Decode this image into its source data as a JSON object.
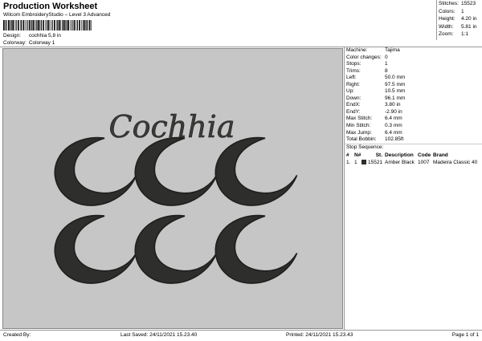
{
  "header": {
    "title": "Production Worksheet",
    "subtitle": "Wilcom EmbroideryStudio – Level 3 Advanced"
  },
  "design": {
    "label": "Design:",
    "value": "cochhia 5,8 in"
  },
  "colorway": {
    "label": "Colorway:",
    "value": "Colorway 1"
  },
  "stats": [
    {
      "k": "Stitches:",
      "v": "15523"
    },
    {
      "k": "Colors:",
      "v": "1"
    },
    {
      "k": "Height:",
      "v": "4.20 in"
    },
    {
      "k": "Width:",
      "v": "5.81 in"
    },
    {
      "k": "Zoom:",
      "v": "1:1"
    }
  ],
  "canvas": {
    "text": "Cochhia",
    "thread_color": "#2e2e2c",
    "bg_color": "#c6c6c6"
  },
  "details": [
    {
      "k": "Machine:",
      "v": "Tajima"
    },
    {
      "k": "Color changes:",
      "v": "0"
    },
    {
      "k": "Stops:",
      "v": "1"
    },
    {
      "k": "Trims:",
      "v": "8"
    },
    {
      "k": "Left:",
      "v": "50.0 mm"
    },
    {
      "k": "Right:",
      "v": "97.5 mm"
    },
    {
      "k": "Up:",
      "v": "10.5 mm"
    },
    {
      "k": "Down:",
      "v": "96.1 mm"
    },
    {
      "k": "EndX:",
      "v": "3.80 in"
    },
    {
      "k": "EndY:",
      "v": "-2.90 in"
    },
    {
      "k": "Max Stitch:",
      "v": "6.4 mm"
    },
    {
      "k": "Min Stitch:",
      "v": "0.3 mm"
    },
    {
      "k": "Max Jump:",
      "v": "6.4 mm"
    },
    {
      "k": "Total Bobbin:",
      "v": "102.85ft"
    }
  ],
  "stop_sequence": {
    "label": "Stop Sequence:",
    "headers": [
      "#",
      "N#",
      "",
      "St.",
      "Description",
      "Code",
      "Brand"
    ],
    "rows": [
      [
        "1.",
        "1",
        "",
        "15521",
        "Amber Black",
        "1007",
        "Madeira Classic 40"
      ]
    ]
  },
  "footer": {
    "created_by": "Created By:",
    "last_saved": "Last Saved: 24/11/2021 15.23.40",
    "printed": "Printed: 24/11/2021 15.23.43",
    "page": "Page 1 of 1"
  }
}
